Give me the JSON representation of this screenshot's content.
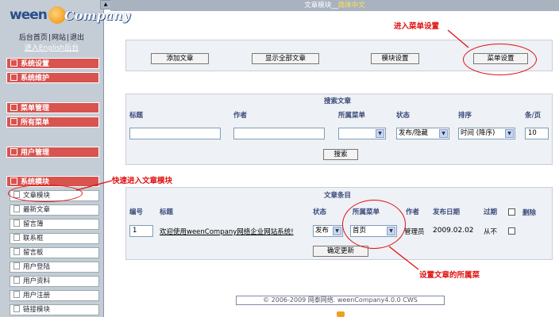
{
  "sidebar": {
    "logo_left": "ween",
    "logo_right": "Company",
    "links": {
      "home": "后台首页",
      "site": "网站",
      "logout": "退出",
      "english": "进入English后台"
    },
    "groups": {
      "system_settings": "系统设置",
      "system_maintain": "系统维护",
      "menu_manage": "菜单管理",
      "all_menus": "所有菜单",
      "user_manage": "用户管理",
      "system_modules": "系统模块"
    },
    "module_items": [
      "文章模块",
      "最新文章",
      "留言簿",
      "联系框",
      "留言板",
      "用户登陆",
      "用户资料",
      "用户注册",
      "链接模块"
    ]
  },
  "topbar": {
    "prefix": "文章模块__",
    "highlight": "简体中文"
  },
  "toolbar": {
    "add": "添加文章",
    "show_all": "显示全部文章",
    "module_settings": "模块设置",
    "menu_settings": "菜单设置"
  },
  "search": {
    "title": "搜索文章",
    "headers": {
      "title": "标题",
      "author": "作者",
      "menu": "所属菜单",
      "status": "状态",
      "sort": "排序",
      "per_page": "条/页"
    },
    "status_value": "发布/隐藏",
    "sort_value": "时间 (降序)",
    "per_page_value": "10",
    "button": "搜索"
  },
  "articles": {
    "title": "文章条目",
    "headers": {
      "num": "编号",
      "title": "标题",
      "status": "状态",
      "menu": "所属菜单",
      "author": "作者",
      "date": "发布日期",
      "expire": "过期",
      "delete": "删除"
    },
    "rows": [
      {
        "num": "1",
        "title": "欢迎使用weenCompany网络企业网站系统!",
        "status": "发布",
        "menu": "首页",
        "author": "管理员",
        "date": "2009.02.02",
        "expire": "从不"
      }
    ],
    "update_button": "确定更新"
  },
  "annotations": {
    "menu_settings": "进入菜单设置",
    "quick_module": "快速进入文章模块",
    "article_menu": "设置文章的所属菜"
  },
  "footer": "© 2006-2009 网泰网络. weenCompany4.0.0 CWS",
  "colors": {
    "accent_red": "#d9534f",
    "annotation": "#e01010",
    "sidebar": "#c4ccd6"
  }
}
